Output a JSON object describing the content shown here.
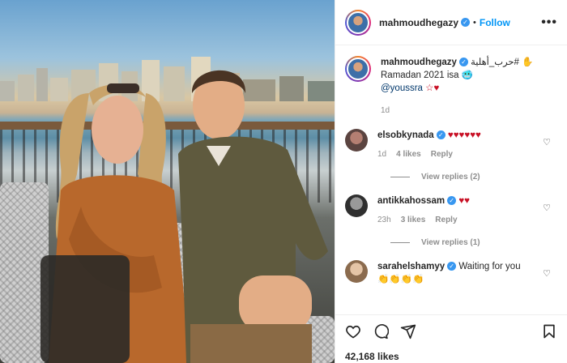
{
  "post": {
    "username": "mahmoudhegazy",
    "follow_label": "Follow",
    "separator": "•",
    "more_label": "•••"
  },
  "caption": {
    "username": "mahmoudhegazy",
    "text_line1": "حرب_أهلية# ✋",
    "text_line2": "Ramadan 2021 isa 🥶",
    "mention": "@youssra",
    "text_end": " ☆♥",
    "time": "1d"
  },
  "comments": [
    {
      "username": "elsobkynada",
      "text": "♥♥♥♥♥♥",
      "time": "1d",
      "likes": "4 likes",
      "reply": "Reply",
      "view_replies": "View replies (2)"
    },
    {
      "username": "antikkahossam",
      "text": "♥♥",
      "time": "23h",
      "likes": "3 likes",
      "reply": "Reply",
      "view_replies": "View replies (1)"
    },
    {
      "username": "sarahelshamyy",
      "text": "Waiting for you",
      "text2": "👏👏👏👏"
    }
  ],
  "footer": {
    "likes": "42,168 likes"
  },
  "icons": [
    "like-icon",
    "comment-icon",
    "share-icon",
    "save-icon",
    "verified-icon",
    "heart-icon"
  ]
}
